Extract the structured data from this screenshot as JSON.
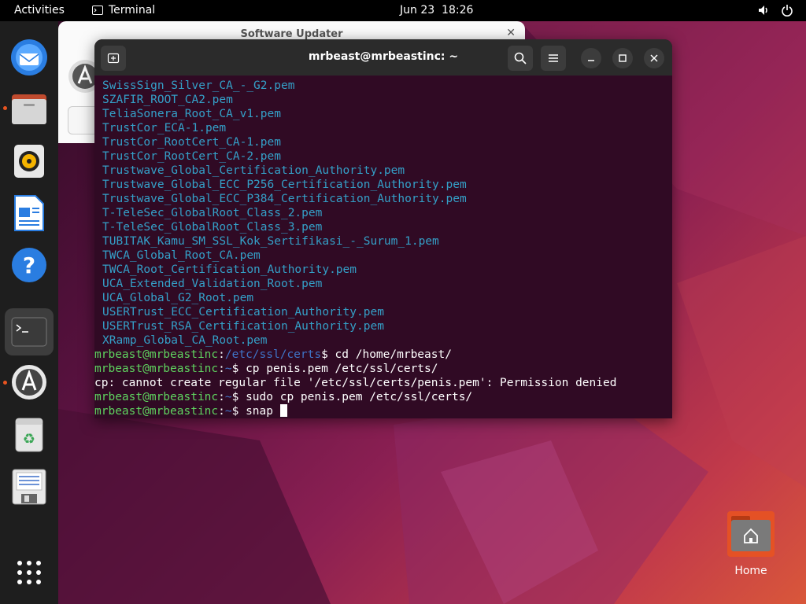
{
  "topbar": {
    "activities": "Activities",
    "app_name": "Terminal",
    "date": "Jun 23",
    "time": "18:26"
  },
  "dock": {
    "items": [
      {
        "name": "thunderbird",
        "icon": "mail-icon"
      },
      {
        "name": "files",
        "icon": "folder-icon"
      },
      {
        "name": "rhythmbox",
        "icon": "music-icon"
      },
      {
        "name": "libreoffice-writer",
        "icon": "document-icon"
      },
      {
        "name": "help",
        "icon": "help-icon"
      },
      {
        "name": "terminal",
        "icon": "terminal-icon"
      },
      {
        "name": "software-updater",
        "icon": "updater-icon"
      },
      {
        "name": "trash",
        "icon": "trash-icon"
      },
      {
        "name": "text-editor",
        "icon": "floppy-icon"
      },
      {
        "name": "show-apps",
        "icon": "grid-icon"
      }
    ]
  },
  "updater": {
    "title": "Software Updater"
  },
  "terminal": {
    "title": "mrbeast@mrbeastinc: ~",
    "files": [
      "SwissSign_Silver_CA_-_G2.pem",
      "SZAFIR_ROOT_CA2.pem",
      "TeliaSonera_Root_CA_v1.pem",
      "TrustCor_ECA-1.pem",
      "TrustCor_RootCert_CA-1.pem",
      "TrustCor_RootCert_CA-2.pem",
      "Trustwave_Global_Certification_Authority.pem",
      "Trustwave_Global_ECC_P256_Certification_Authority.pem",
      "Trustwave_Global_ECC_P384_Certification_Authority.pem",
      "T-TeleSec_GlobalRoot_Class_2.pem",
      "T-TeleSec_GlobalRoot_Class_3.pem",
      "TUBITAK_Kamu_SM_SSL_Kok_Sertifikasi_-_Surum_1.pem",
      "TWCA_Global_Root_CA.pem",
      "TWCA_Root_Certification_Authority.pem",
      "UCA_Extended_Validation_Root.pem",
      "UCA_Global_G2_Root.pem",
      "USERTrust_ECC_Certification_Authority.pem",
      "USERTrust_RSA_Certification_Authority.pem",
      "XRamp_Global_CA_Root.pem"
    ],
    "prompts": [
      {
        "user": "mrbeast@mrbeastinc",
        "path": "/etc/ssl/certs",
        "cmd": "$ cd /home/mrbeast/"
      },
      {
        "user": "mrbeast@mrbeastinc",
        "path": "~",
        "cmd": "$ cp penis.pem /etc/ssl/certs/"
      },
      {
        "output": "cp: cannot create regular file '/etc/ssl/certs/penis.pem': Permission denied"
      },
      {
        "user": "mrbeast@mrbeastinc",
        "path": "~",
        "cmd": "$ sudo cp penis.pem /etc/ssl/certs/"
      },
      {
        "user": "mrbeast@mrbeastinc",
        "path": "~",
        "cmd": "$ snap "
      }
    ]
  },
  "desktop": {
    "home_label": "Home"
  },
  "colors": {
    "terminal_bg": "#300a24",
    "file_color": "#34a0c8",
    "prompt_user": "#5fd35f",
    "prompt_path": "#3f74c7",
    "accent": "#e95420"
  }
}
